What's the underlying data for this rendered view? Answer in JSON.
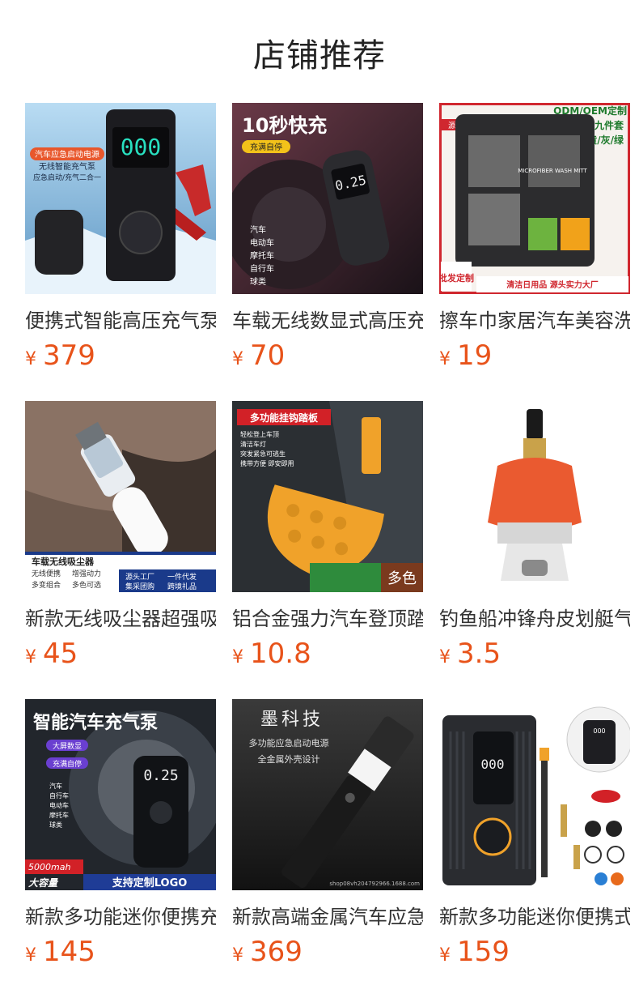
{
  "header": {
    "title": "店铺推荐"
  },
  "currency_symbol": "¥",
  "products": [
    {
      "name": "便携式智能高压充气泵",
      "price": "379",
      "badges": [
        "汽车应急启动电源",
        "无线智能充气泵",
        "应急启动/充气二合一"
      ],
      "screen": "000",
      "icon": "car-jump-starter-icon"
    },
    {
      "name": "车载无线数显式高压充气泵",
      "price": "70",
      "badges": [
        "10秒快充",
        "充满自停",
        "汽车",
        "电动车",
        "摩托车",
        "自行车",
        "球类"
      ],
      "screen": "0.25",
      "icon": "tire-inflator-icon"
    },
    {
      "name": "擦车巾家居汽车美容洗车套装",
      "price": "19",
      "badges": [
        "ODM/OEM定制",
        "清洁九件套",
        "黄/灰/绿",
        "源头工厂",
        "MICROFIBER WASH MITT",
        "批发定制",
        "清洁日用品 源头实力大厂"
      ],
      "icon": "microfiber-kit-icon"
    },
    {
      "name": "新款无线吸尘器超强吸力",
      "price": "45",
      "badges": [
        "车载无线吸尘器",
        "无线便携",
        "增强动力",
        "多变组合",
        "多色可选",
        "源头工厂",
        "一件代发",
        "集采团购",
        "跨境礼品"
      ],
      "icon": "vacuum-icon"
    },
    {
      "name": "铝合金强力汽车登顶踏板",
      "price": "10.8",
      "badges": [
        "多功能挂钩踏板",
        "轻松登上车顶",
        "清洁车灯",
        "突发紧急可逃生",
        "携带方便 即安即用",
        "多色"
      ],
      "icon": "door-step-icon"
    },
    {
      "name": "钓鱼船冲锋舟皮划艇气嘴",
      "price": "3.5",
      "badges": [],
      "icon": "valve-adapter-icon"
    },
    {
      "name": "新款多功能迷你便携充气泵",
      "price": "145",
      "badges": [
        "智能汽车充气泵",
        "大屏数显",
        "充满自停",
        "汽车",
        "自行车",
        "电动车",
        "摩托车",
        "球类",
        "5000mah",
        "大容量",
        "支持定制LOGO"
      ],
      "screen": "0.25",
      "icon": "smart-pump-icon"
    },
    {
      "name": "新款高端金属汽车应急启动电源",
      "price": "369",
      "badges": [
        "墨科技",
        "多功能应急启动电源",
        "全金属外壳设计",
        "shop08vh204792966.1688.com"
      ],
      "icon": "flashlight-icon"
    },
    {
      "name": "新款多功能迷你便携式充气泵",
      "price": "159",
      "badges": [
        "000"
      ],
      "screen": "000",
      "icon": "portable-pump-icon"
    }
  ]
}
